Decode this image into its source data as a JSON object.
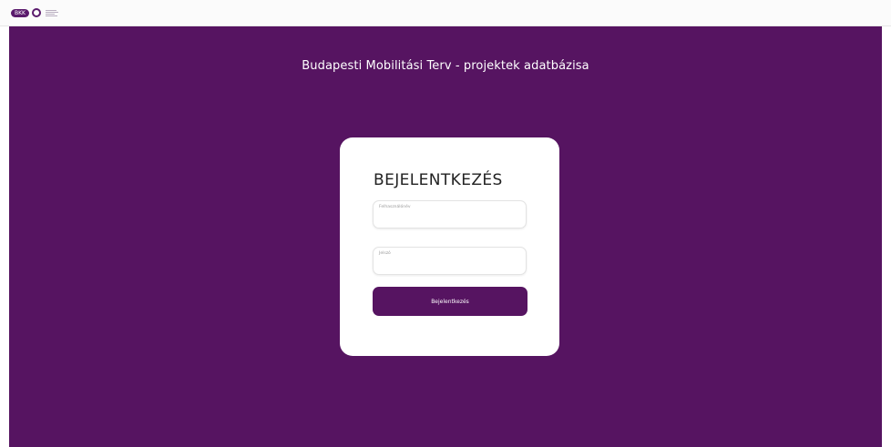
{
  "header": {
    "logo_text": "BKK"
  },
  "main": {
    "title": "Budapesti Mobilitási Terv - projektek adatbázisa"
  },
  "login": {
    "heading": "BEJELENTKEZÉS",
    "username_label": "Felhasználónév",
    "username_value": "",
    "password_label": "Jelszó",
    "password_value": "",
    "submit_label": "Bejelentkezés"
  },
  "colors": {
    "brand": "#561461",
    "card": "#ffffff"
  }
}
